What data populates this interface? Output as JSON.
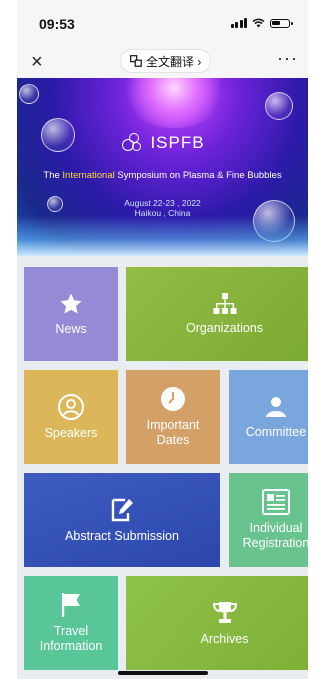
{
  "status_bar": {
    "time": "09:53"
  },
  "nav_bar": {
    "close_glyph": "×",
    "translate_label": "全文翻译 ›",
    "more_glyph": "···"
  },
  "banner": {
    "logo_text": "ISPFB",
    "title_pre": "The ",
    "title_highlight": "International",
    "title_post": " Symposium on Plasma & Fine Bubbles",
    "date": "August 22-23 , 2022",
    "location": "Haikou , China"
  },
  "tiles": {
    "news": "News",
    "organizations": "Organizations",
    "speakers": "Speakers",
    "important_dates_l1": "Important",
    "important_dates_l2": "Dates",
    "committee": "Committee",
    "abstract_submission": "Abstract Submission",
    "individual_l1": "Individual",
    "individual_l2": "Registration",
    "travel_l1": "Travel",
    "travel_l2": "Information",
    "archives": "Archives"
  },
  "colors": {
    "news": "#958ad5",
    "organizations": "#8ab63a",
    "speakers": "#dcb75a",
    "important_dates": "#d3a067",
    "committee": "#78a6dd",
    "abstract_submission": "#3451b6",
    "individual_registration": "#68c38e",
    "travel_information": "#59c69a",
    "archives": "#8aba3c"
  },
  "icons": [
    "close-icon",
    "translate-icon",
    "more-icon",
    "star-icon",
    "org-chart-icon",
    "person-icon",
    "clock-icon",
    "group-icon",
    "edit-icon",
    "document-icon",
    "flag-icon",
    "trophy-icon"
  ]
}
